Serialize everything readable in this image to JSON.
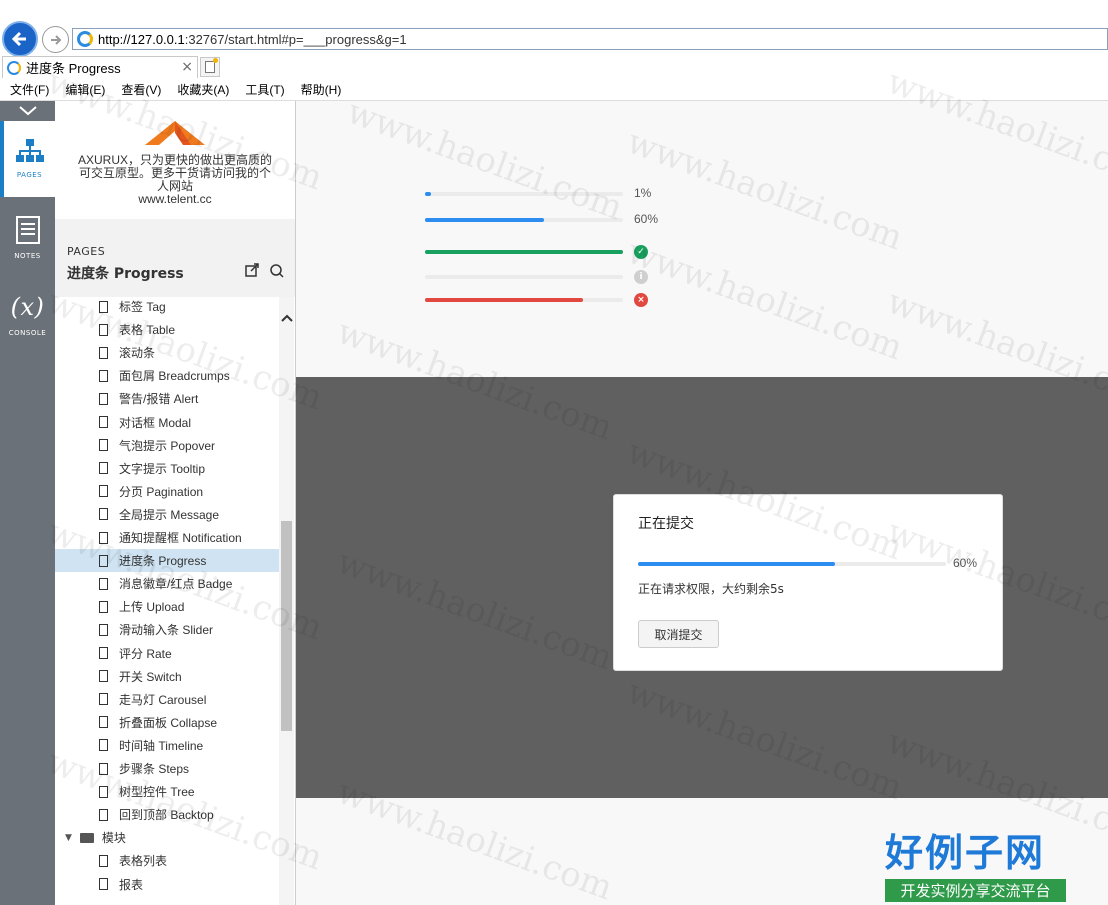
{
  "browser": {
    "url_host": "http://127.0.0.1",
    "url_rest": ":32767/start.html#p=___progress&g=1",
    "tab_title": "进度条 Progress",
    "tab_close": "×",
    "menu": [
      "文件(F)",
      "编辑(E)",
      "查看(V)",
      "收藏夹(A)",
      "工具(T)",
      "帮助(H)"
    ]
  },
  "strip": {
    "collapse_glyph": "﹀",
    "items": [
      {
        "label": "PAGES",
        "icon": "sitemap-icon",
        "active": true
      },
      {
        "label": "NOTES",
        "icon": "notes-icon",
        "active": false
      },
      {
        "label": "CONSOLE",
        "icon": "variable-x-icon",
        "glyph": "(x)",
        "active": false
      }
    ]
  },
  "sidebar": {
    "brand_text": "AXURUX，只为更快的做出更高质的可交互原型。更多干货请访问我的个人网站",
    "brand_site": "www.telent.cc",
    "pages_label": "PAGES",
    "pages_title": "进度条 Progress",
    "tree": [
      "标签 Tag",
      "表格 Table",
      "滚动条",
      "面包屑 Breadcrumps",
      "警告/报错 Alert",
      "对话框 Modal",
      "气泡提示 Popover",
      "文字提示 Tooltip",
      "分页 Pagination",
      "全局提示 Message",
      "通知提醒框 Notification",
      "进度条 Progress",
      "消息徽章/红点 Badge",
      "上传 Upload",
      "滑动输入条 Slider",
      "评分 Rate",
      "开关 Switch",
      "走马灯 Carousel",
      "折叠面板 Collapse",
      "时间轴 Timeline",
      "步骤条 Steps",
      "树型控件 Tree",
      "回到顶部 Backtop"
    ],
    "selected_index": 11,
    "folder": "模块",
    "folder_children": [
      "表格列表",
      "报表"
    ]
  },
  "progress_bars": [
    {
      "percent": 1,
      "label": "1%",
      "color": "#2d8cf0",
      "status": "text"
    },
    {
      "percent": 60,
      "label": "60%",
      "color": "#2d8cf0",
      "status": "text"
    },
    {
      "percent": 100,
      "label": "",
      "color": "#19a15f",
      "status": "success"
    },
    {
      "percent": 0,
      "label": "",
      "color": "#2d8cf0",
      "status": "waiting"
    },
    {
      "percent": 80,
      "label": "",
      "color": "#e04840",
      "status": "error"
    }
  ],
  "dialog": {
    "title": "正在提交",
    "percent": 64,
    "percent_label": "60%",
    "message": "正在请求权限，大约剩余5s",
    "cancel_label": "取消提交"
  },
  "watermark": {
    "site": "www.haolizi.com",
    "brand": "好例子网",
    "tagline": "开发实例分享交流平台"
  },
  "colors": {
    "accent": "#2d8cf0",
    "success": "#19a15f",
    "error": "#e04840",
    "overlay": "#606060",
    "strip": "#6b7178",
    "selected": "#cfe3f3"
  }
}
